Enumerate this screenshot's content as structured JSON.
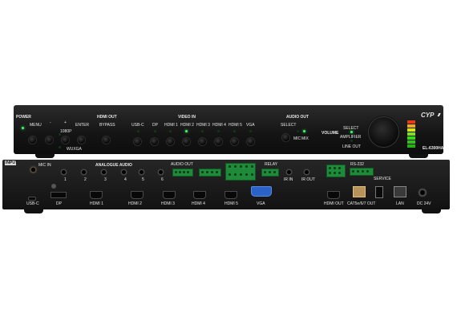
{
  "brand": "CYP",
  "model": "EL-6300HA",
  "front": {
    "power": "POWER",
    "menu": "MENU",
    "minus": "-",
    "plus": "+",
    "enter": "ENTER",
    "p1080": "1080P",
    "wuxga": "WUXGA",
    "hdmi_out": "HDMI OUT",
    "bypass": "BYPASS",
    "video_in": "VIDEO IN",
    "inputs": [
      "USB-C",
      "DP",
      "HDMI 1",
      "HDMI 2",
      "HDMI 3",
      "HDMI 4",
      "HDMI 5",
      "VGA"
    ],
    "audio_out": "AUDIO OUT",
    "select": "SELECT",
    "mic": "MIC",
    "mix": "MIX",
    "volume": "VOLUME",
    "vol_select": "SELECT",
    "amplifier": "AMPLIFIER",
    "line_out": "LINE OUT"
  },
  "rear": {
    "input": "INPUT",
    "mic_in": "MIC IN",
    "analogue_audio": "ANALOGUE AUDIO",
    "analogue_nums": [
      "1",
      "2",
      "3",
      "4",
      "5",
      "6"
    ],
    "audio_out": "AUDIO OUT",
    "relay": "RELAY",
    "ir_in": "IR IN",
    "ir_out": "IR OUT",
    "rs232": "RS-232",
    "service": "SERVICE",
    "usbc": "USB-C",
    "dp": "DP",
    "hdmi_ports": [
      "HDMI 1",
      "HDMI 2",
      "HDMI 3",
      "HDMI 4",
      "HDMI 5"
    ],
    "vga": "VGA",
    "hdmi_out": "HDMI OUT",
    "cat_out": "CAT5e/6/7 OUT",
    "lan": "LAN",
    "dc": "DC 24V"
  },
  "colors": {
    "led_on": "#3cff6a",
    "terminal": "#1f8a3a",
    "chassis": "#141414"
  }
}
